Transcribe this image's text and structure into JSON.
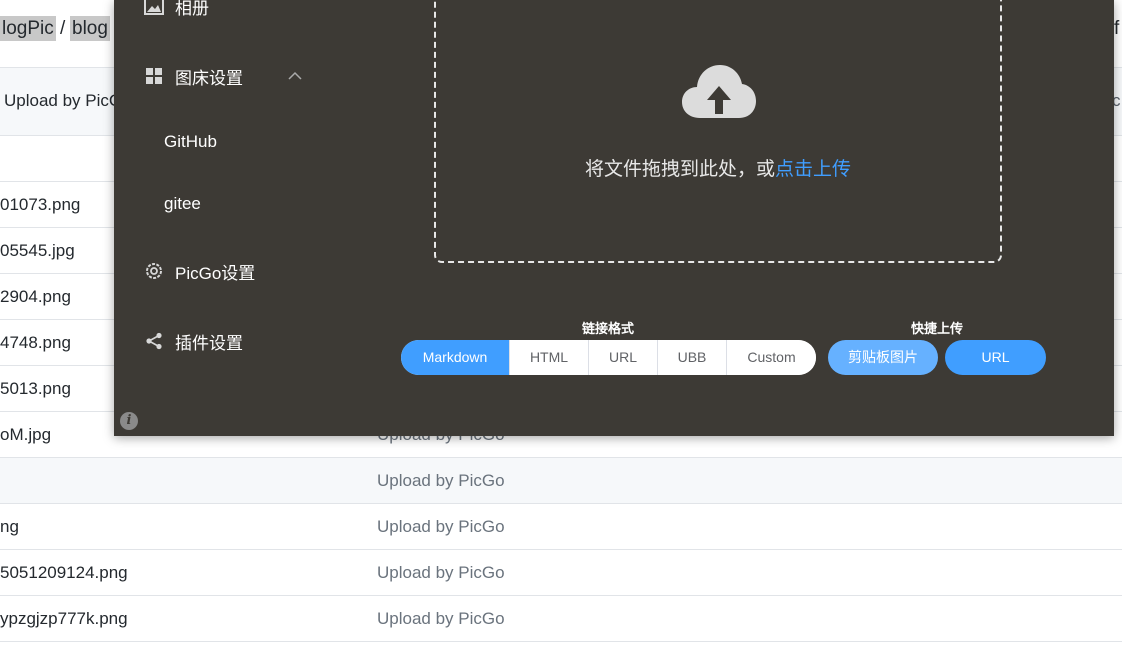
{
  "breadcrumb": {
    "part1": "logPic",
    "separator": "/",
    "part2": "blog",
    "right_fragment": "f"
  },
  "commit": {
    "message": "Upload by PicG",
    "right_fragment": "c"
  },
  "files": [
    {
      "name": "",
      "message": ""
    },
    {
      "name": "01073.png",
      "message": ""
    },
    {
      "name": "05545.jpg",
      "message": ""
    },
    {
      "name": "2904.png",
      "message": ""
    },
    {
      "name": "4748.png",
      "message": ""
    },
    {
      "name": "5013.png",
      "message": ""
    },
    {
      "name": "oM.jpg",
      "message": "Upload by PicGo"
    },
    {
      "name": "",
      "message": "Upload by PicGo"
    },
    {
      "name": "ng",
      "message": "Upload by PicGo"
    },
    {
      "name": "5051209124.png",
      "message": "Upload by PicGo"
    },
    {
      "name": "ypzgjzp777k.png",
      "message": "Upload by PicGo"
    }
  ],
  "picgo": {
    "nav": {
      "album": "相册",
      "picbed_settings": "图床设置",
      "sub_items": [
        "GitHub",
        "gitee"
      ],
      "picgo_settings": "PicGo设置",
      "plugin_settings": "插件设置"
    },
    "upload": {
      "drag_text": "将文件拖拽到此处，或",
      "click_link": "点击上传"
    },
    "link_format": {
      "label": "链接格式",
      "options": [
        "Markdown",
        "HTML",
        "URL",
        "UBB",
        "Custom"
      ],
      "selected": "Markdown"
    },
    "quick_upload": {
      "label": "快捷上传",
      "clipboard_button": "剪贴板图片",
      "url_button": "URL"
    },
    "info_icon": "i",
    "colors": {
      "window_bg": "#3d3a35",
      "accent": "#409eff",
      "accent_light": "#66b1ff"
    }
  }
}
